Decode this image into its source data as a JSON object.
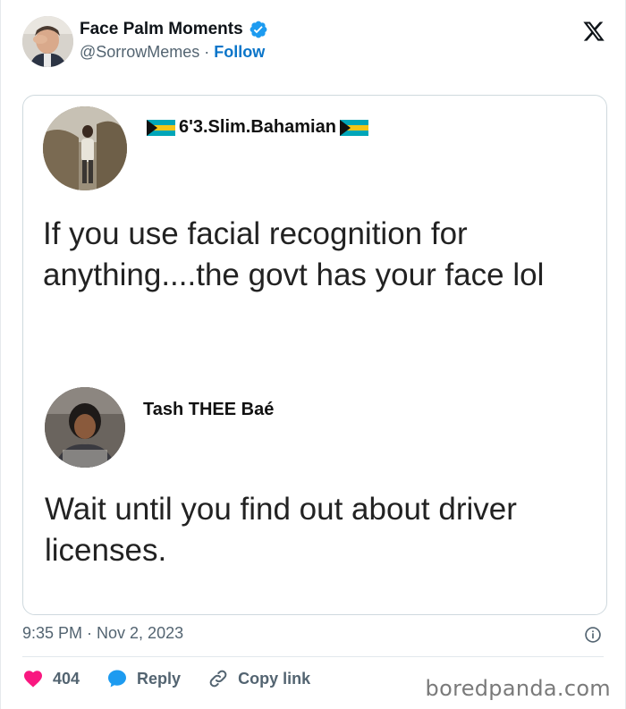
{
  "author": {
    "name": "Face Palm Moments",
    "handle": "@SorrowMemes",
    "separator": "·",
    "follow_label": "Follow"
  },
  "embedded": {
    "post1": {
      "username": "6'3.Slim.Bahamian",
      "text": "If you use facial recognition for anything....the govt has your face lol"
    },
    "post2": {
      "username": "Tash THEE Baé",
      "text": "Wait until you find out about driver licenses."
    }
  },
  "timestamp": "9:35 PM · Nov 2, 2023",
  "actions": {
    "likes_count": "404",
    "reply_label": "Reply",
    "copy_link_label": "Copy link"
  },
  "watermark": "boredpanda.com",
  "icons": {
    "verified": "verified-badge-icon",
    "x_logo": "x-logo-icon",
    "flag": "bahamas-flag-icon",
    "info": "info-icon",
    "heart": "heart-icon",
    "reply": "speech-bubble-icon",
    "link": "link-icon"
  },
  "colors": {
    "accent": "#0a75c9",
    "verified": "#1d9bf0",
    "like": "#f91880",
    "reply": "#1d9bf0",
    "muted": "#536471"
  }
}
